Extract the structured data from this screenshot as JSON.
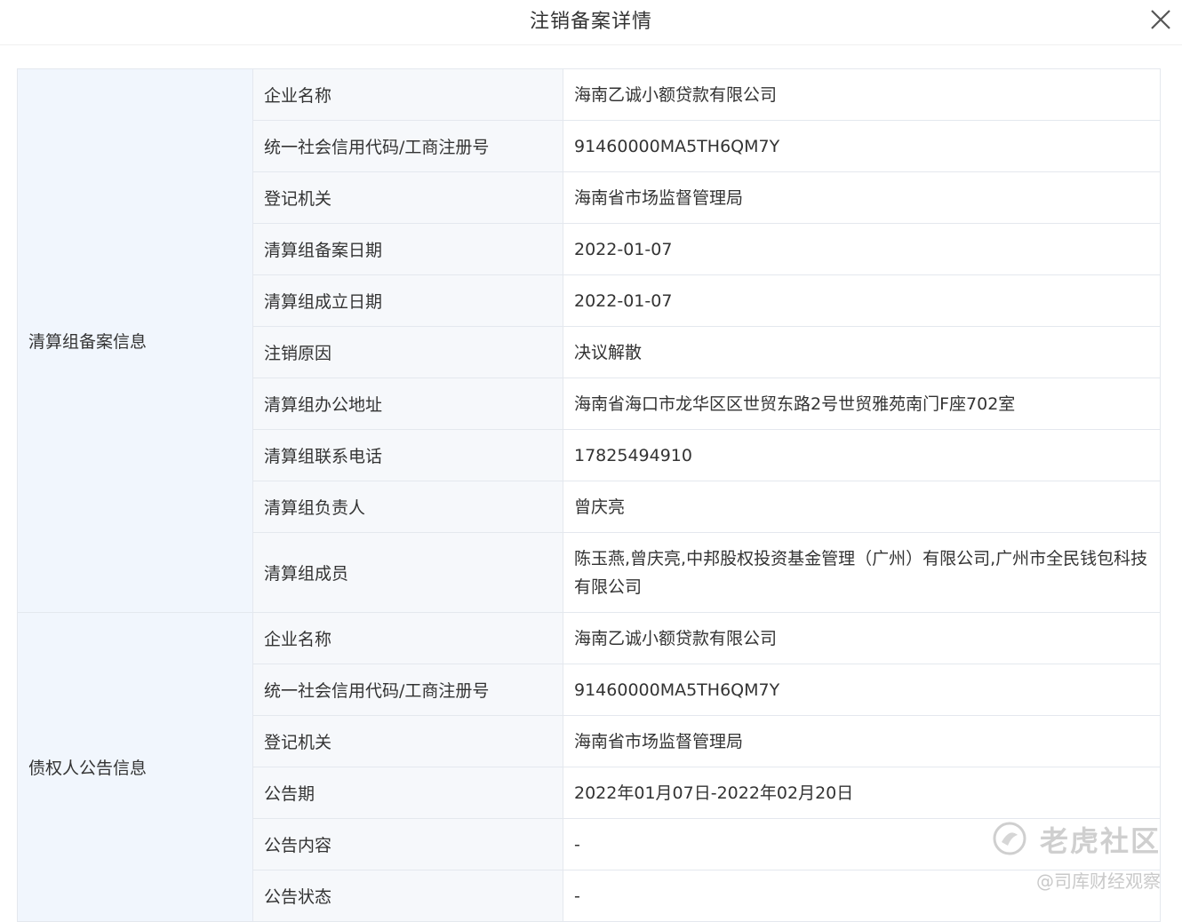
{
  "dialog": {
    "title": "注销备案详情"
  },
  "sections": [
    {
      "name": "清算组备案信息",
      "rows": [
        {
          "label": "企业名称",
          "value": "海南乙诚小额贷款有限公司"
        },
        {
          "label": "统一社会信用代码/工商注册号",
          "value": "91460000MA5TH6QM7Y"
        },
        {
          "label": "登记机关",
          "value": "海南省市场监督管理局"
        },
        {
          "label": "清算组备案日期",
          "value": "2022-01-07"
        },
        {
          "label": "清算组成立日期",
          "value": "2022-01-07"
        },
        {
          "label": "注销原因",
          "value": "决议解散"
        },
        {
          "label": "清算组办公地址",
          "value": "海南省海口市龙华区区世贸东路2号世贸雅苑南门F座702室"
        },
        {
          "label": "清算组联系电话",
          "value": "17825494910"
        },
        {
          "label": "清算组负责人",
          "value": "曾庆亮"
        },
        {
          "label": "清算组成员",
          "value": "陈玉燕,曾庆亮,中邦股权投资基金管理（广州）有限公司,广州市全民钱包科技有限公司"
        }
      ]
    },
    {
      "name": "债权人公告信息",
      "rows": [
        {
          "label": "企业名称",
          "value": "海南乙诚小额贷款有限公司"
        },
        {
          "label": "统一社会信用代码/工商注册号",
          "value": "91460000MA5TH6QM7Y"
        },
        {
          "label": "登记机关",
          "value": "海南省市场监督管理局"
        },
        {
          "label": "公告期",
          "value": "2022年01月07日-2022年02月20日"
        },
        {
          "label": "公告内容",
          "value": "-"
        },
        {
          "label": "公告状态",
          "value": "-"
        }
      ]
    }
  ],
  "watermark": {
    "brand": "老虎社区",
    "sub": "@司库财经观察",
    "icon": "tiger-logo-icon"
  }
}
